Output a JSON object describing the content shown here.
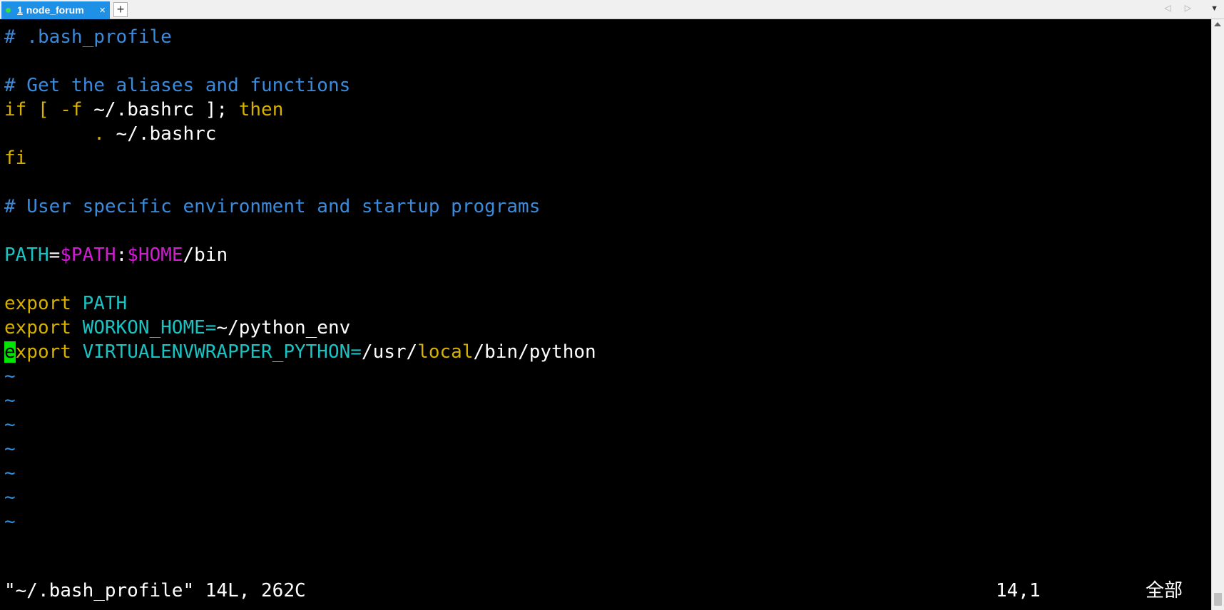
{
  "tab": {
    "index": "1",
    "title": "node_forum",
    "close": "×",
    "add": "+",
    "nav_arrows": "◁ ▷",
    "menu": "▼",
    "active_color": "#1e90e6",
    "status_dot_color": "#3cdc3c"
  },
  "editor": {
    "lines": [
      [
        {
          "t": "# .bash_profile",
          "c": "comment"
        }
      ],
      [],
      [
        {
          "t": "# Get the aliases and functions",
          "c": "comment"
        }
      ],
      [
        {
          "t": "if [ -f ",
          "c": "keyword"
        },
        {
          "t": "~/.bashrc ]; ",
          "c": "plain"
        },
        {
          "t": "then",
          "c": "keyword"
        }
      ],
      [
        {
          "t": "        . ",
          "c": "keyword"
        },
        {
          "t": "~/.bashrc",
          "c": "plain"
        }
      ],
      [
        {
          "t": "fi",
          "c": "keyword"
        }
      ],
      [],
      [
        {
          "t": "# User specific environment and startup programs",
          "c": "comment"
        }
      ],
      [],
      [
        {
          "t": "PATH",
          "c": "ident"
        },
        {
          "t": "=",
          "c": "plain"
        },
        {
          "t": "$PATH",
          "c": "var"
        },
        {
          "t": ":",
          "c": "plain"
        },
        {
          "t": "$HOME",
          "c": "var"
        },
        {
          "t": "/bin",
          "c": "plain"
        }
      ],
      [],
      [
        {
          "t": "export ",
          "c": "keyword"
        },
        {
          "t": "PATH",
          "c": "ident"
        }
      ],
      [
        {
          "t": "export ",
          "c": "keyword"
        },
        {
          "t": "WORKON_HOME=",
          "c": "ident"
        },
        {
          "t": "~/python_env",
          "c": "plain"
        }
      ],
      [
        {
          "t": "e",
          "c": "cursor"
        },
        {
          "t": "xport ",
          "c": "keyword"
        },
        {
          "t": "VIRTUALENVWRAPPER_PYTHON=",
          "c": "ident"
        },
        {
          "t": "/usr/",
          "c": "plain"
        },
        {
          "t": "local",
          "c": "keyword"
        },
        {
          "t": "/bin/python",
          "c": "plain"
        }
      ]
    ],
    "empty_line_marker": "~",
    "empty_line_count": 7
  },
  "status": {
    "message": "\"~/.bash_profile\" 14L, 262C",
    "position": "14,1",
    "scroll_percent": "全部"
  },
  "colors": {
    "comment": "#3a8bdc",
    "keyword": "#d7b000",
    "ident": "#17c3c3",
    "var": "#d21cd2",
    "cursor": "#00e600",
    "background": "#000000"
  }
}
